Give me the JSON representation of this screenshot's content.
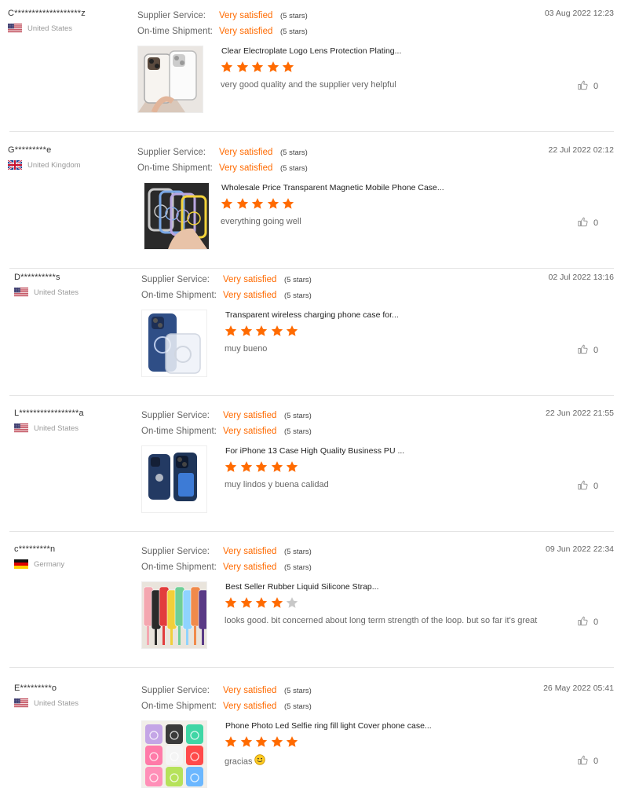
{
  "labels": {
    "supplier_service": "Supplier Service:",
    "ontime_shipment": "On-time Shipment:"
  },
  "colors": {
    "accent": "#ff6a00",
    "star_empty": "#c8c8c8"
  },
  "reviews": [
    {
      "user": "C*******************z",
      "country": "United States",
      "flag": "us-flag-icon",
      "supplier_service": "Very satisfied",
      "supplier_stars_text": "(5 stars)",
      "ontime_shipment": "Very satisfied",
      "ontime_stars_text": "(5 stars)",
      "date": "03 Aug 2022 12:23",
      "product_title": "Clear Electroplate Logo Lens Protection Plating...",
      "rating": 5,
      "comment": "very good quality and the supplier very helpful",
      "likes": "0",
      "thumb_theme": "clear-lens-case"
    },
    {
      "user": "G*********e",
      "country": "United Kingdom",
      "flag": "uk-flag-icon",
      "supplier_service": "Very satisfied",
      "supplier_stars_text": "(5 stars)",
      "ontime_shipment": "Very satisfied",
      "ontime_stars_text": "(5 stars)",
      "date": "22 Jul 2022 02:12",
      "product_title": "Wholesale Price Transparent Magnetic Mobile Phone Case...",
      "rating": 5,
      "comment": "everything going well",
      "likes": "0",
      "thumb_theme": "magnetic-cases-dark"
    },
    {
      "user": "D**********s",
      "country": "United States",
      "flag": "us-flag-icon",
      "supplier_service": "Very satisfied",
      "supplier_stars_text": "(5 stars)",
      "ontime_shipment": "Very satisfied",
      "ontime_stars_text": "(5 stars)",
      "date": "02 Jul 2022 13:16",
      "product_title": "Transparent wireless charging phone case for...",
      "rating": 5,
      "comment": "muy bueno",
      "likes": "0",
      "thumb_theme": "clear-magsafe-case"
    },
    {
      "user": "L*****************a",
      "country": "United States",
      "flag": "us-flag-icon",
      "supplier_service": "Very satisfied",
      "supplier_stars_text": "(5 stars)",
      "ontime_shipment": "Very satisfied",
      "ontime_stars_text": "(5 stars)",
      "date": "22 Jun 2022 21:55",
      "product_title": "For iPhone 13 Case High Quality Business PU ...",
      "rating": 5,
      "comment": "muy lindos y buena calidad",
      "likes": "0",
      "thumb_theme": "navy-pu-case"
    },
    {
      "user": "c*********n",
      "country": "Germany",
      "flag": "de-flag-icon",
      "supplier_service": "Very satisfied",
      "supplier_stars_text": "(5 stars)",
      "ontime_shipment": "Very satisfied",
      "ontime_stars_text": "(5 stars)",
      "date": "09 Jun 2022 22:34",
      "product_title": "Best Seller Rubber Liquid Silicone Strap...",
      "rating": 4,
      "comment": "looks good. bit concerned about long term strength of the loop. but so far it's great",
      "likes": "0",
      "thumb_theme": "silicone-strap-cases"
    },
    {
      "user": "E*********o",
      "country": "United States",
      "flag": "us-flag-icon",
      "supplier_service": "Very satisfied",
      "supplier_stars_text": "(5 stars)",
      "ontime_shipment": "Very satisfied",
      "ontime_stars_text": "(5 stars)",
      "date": "26 May 2022 05:41",
      "product_title": "Phone Photo Led Selfie ring fill light Cover phone case...",
      "rating": 5,
      "comment": "gracias",
      "comment_emoji": "smile-emoji-icon",
      "likes": "0",
      "thumb_theme": "colorful-ring-cases"
    }
  ]
}
